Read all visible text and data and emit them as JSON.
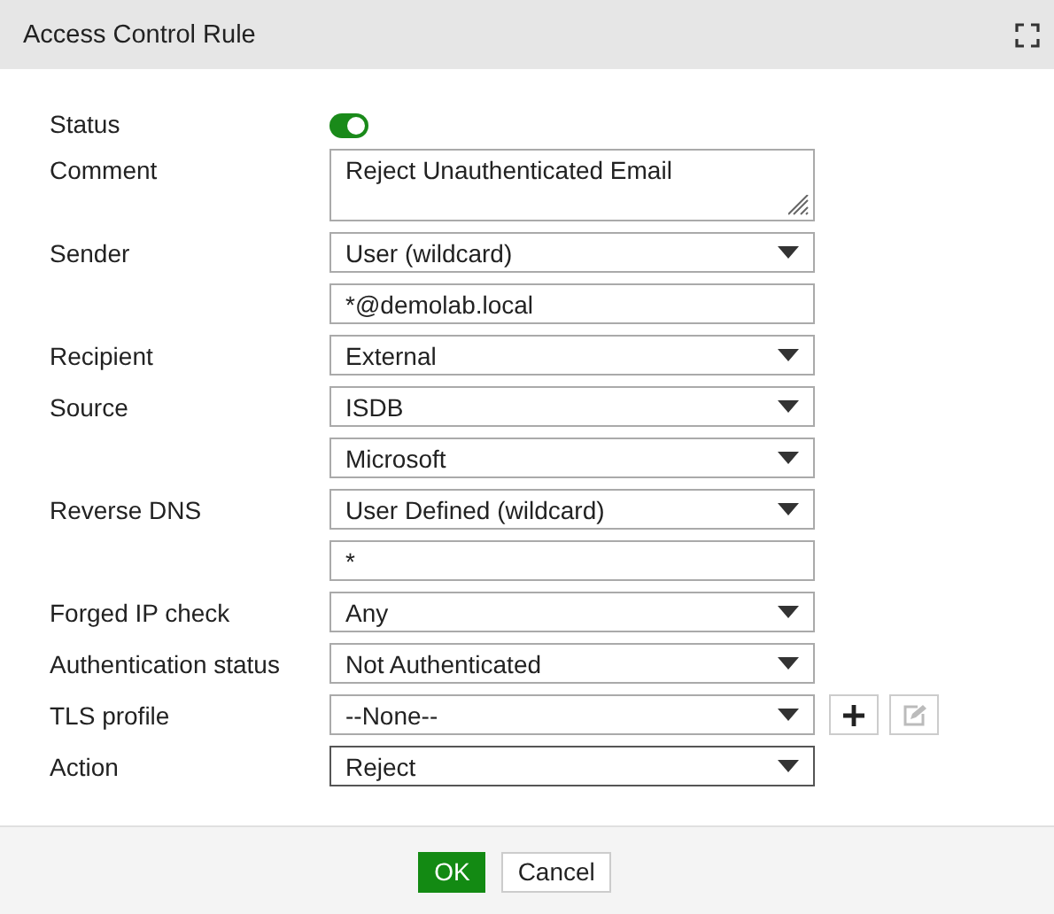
{
  "window": {
    "title": "Access Control Rule"
  },
  "fields": [
    {
      "label": "Status",
      "kind": "toggle",
      "on": true
    },
    {
      "label": "Comment",
      "kind": "textarea",
      "value": "Reject Unauthenticated Email"
    },
    {
      "label": "Sender",
      "kind": "select",
      "value": "User (wildcard)"
    },
    {
      "kind": "text",
      "value": "*@demolab.local"
    },
    {
      "label": "Recipient",
      "kind": "select",
      "value": "External"
    },
    {
      "label": "Source",
      "kind": "select",
      "value": "ISDB"
    },
    {
      "kind": "select",
      "value": "Microsoft"
    },
    {
      "label": "Reverse DNS",
      "kind": "select",
      "value": "User Defined (wildcard)"
    },
    {
      "kind": "text",
      "value": "*"
    },
    {
      "label": "Forged IP check",
      "kind": "select",
      "value": "Any"
    },
    {
      "label": "Authentication status",
      "kind": "select",
      "value": "Not Authenticated"
    },
    {
      "label": "TLS profile",
      "kind": "select",
      "value": "--None--",
      "actions": [
        {
          "kind": "add",
          "disabled": false
        },
        {
          "kind": "edit",
          "disabled": true
        }
      ]
    },
    {
      "label": "Action",
      "kind": "select",
      "value": "Reject",
      "focused": true
    }
  ],
  "buttons": [
    {
      "label": "OK",
      "primary": true
    },
    {
      "label": "Cancel",
      "primary": false
    }
  ]
}
